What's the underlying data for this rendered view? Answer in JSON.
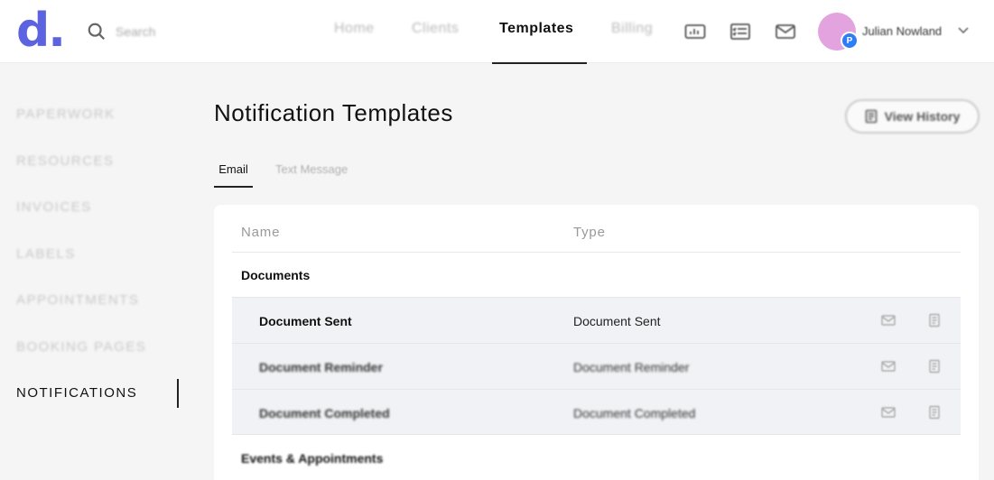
{
  "brand": {
    "logo_text": "d",
    "logo_dot": ".",
    "accent": "#5b63e0"
  },
  "search": {
    "placeholder": "Search"
  },
  "nav": {
    "items": [
      {
        "label": "Home"
      },
      {
        "label": "Clients"
      },
      {
        "label": "Templates",
        "active": true
      },
      {
        "label": "Billing"
      }
    ]
  },
  "toolbar_icons": [
    "analytics-icon",
    "checklist-icon",
    "mail-icon"
  ],
  "user": {
    "name": "Julian Nowland",
    "badge": "P",
    "avatar_color": "#e3a3df",
    "badge_color": "#2f7df6"
  },
  "sidebar": {
    "items": [
      {
        "label": "PAPERWORK"
      },
      {
        "label": "RESOURCES"
      },
      {
        "label": "INVOICES"
      },
      {
        "label": "LABELS"
      },
      {
        "label": "APPOINTMENTS"
      },
      {
        "label": "BOOKING PAGES"
      },
      {
        "label": "NOTIFICATIONS",
        "active": true
      }
    ]
  },
  "page": {
    "title": "Notification Templates",
    "history_button": "View History"
  },
  "tabs": [
    {
      "label": "Email",
      "active": true
    },
    {
      "label": "Text Message"
    }
  ],
  "table": {
    "columns": [
      "Name",
      "Type"
    ],
    "groups": [
      {
        "label": "Documents",
        "rows": [
          {
            "name": "Document Sent",
            "type": "Document Sent"
          },
          {
            "name": "Document Reminder",
            "type": "Document Reminder"
          },
          {
            "name": "Document Completed",
            "type": "Document Completed"
          }
        ]
      },
      {
        "label": "Events & Appointments",
        "rows": []
      }
    ]
  }
}
